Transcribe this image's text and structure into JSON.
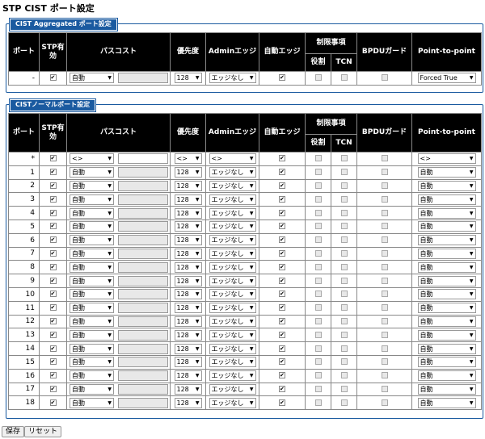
{
  "page_title": "STP CIST ポート設定",
  "agg_legend": "CIST Aggregated ポート設定",
  "normal_legend": "CISTノーマルポート設定",
  "headers": {
    "port": "ポート",
    "stp_enabled": "STP有効",
    "path_cost": "パスコスト",
    "priority": "優先度",
    "admin_edge": "Adminエッジ",
    "auto_edge": "自動エッジ",
    "restricted": "制限事項",
    "role": "役割",
    "tcn": "TCN",
    "bpdu_guard": "BPDUガード",
    "p2p": "Point-to-point"
  },
  "agg_row": {
    "port": "-",
    "stp": true,
    "path_cost": "自動",
    "priority": "128",
    "admin_edge": "エッジなし",
    "auto_edge": true,
    "role": false,
    "tcn": false,
    "bpdu": false,
    "p2p": "Forced True"
  },
  "wildcard_row": {
    "port": "*",
    "stp": true,
    "path_cost": "<>",
    "priority": "<>",
    "admin_edge": "<>",
    "auto_edge": true,
    "role": false,
    "tcn": false,
    "bpdu": false,
    "p2p": "<>"
  },
  "port_rows": [
    {
      "port": "1",
      "path_cost": "自動",
      "priority": "128",
      "admin_edge": "エッジなし",
      "p2p": "自動"
    },
    {
      "port": "2",
      "path_cost": "自動",
      "priority": "128",
      "admin_edge": "エッジなし",
      "p2p": "自動"
    },
    {
      "port": "3",
      "path_cost": "自動",
      "priority": "128",
      "admin_edge": "エッジなし",
      "p2p": "自動"
    },
    {
      "port": "4",
      "path_cost": "自動",
      "priority": "128",
      "admin_edge": "エッジなし",
      "p2p": "自動"
    },
    {
      "port": "5",
      "path_cost": "自動",
      "priority": "128",
      "admin_edge": "エッジなし",
      "p2p": "自動"
    },
    {
      "port": "6",
      "path_cost": "自動",
      "priority": "128",
      "admin_edge": "エッジなし",
      "p2p": "自動"
    },
    {
      "port": "7",
      "path_cost": "自動",
      "priority": "128",
      "admin_edge": "エッジなし",
      "p2p": "自動"
    },
    {
      "port": "8",
      "path_cost": "自動",
      "priority": "128",
      "admin_edge": "エッジなし",
      "p2p": "自動"
    },
    {
      "port": "9",
      "path_cost": "自動",
      "priority": "128",
      "admin_edge": "エッジなし",
      "p2p": "自動"
    },
    {
      "port": "10",
      "path_cost": "自動",
      "priority": "128",
      "admin_edge": "エッジなし",
      "p2p": "自動"
    },
    {
      "port": "11",
      "path_cost": "自動",
      "priority": "128",
      "admin_edge": "エッジなし",
      "p2p": "自動"
    },
    {
      "port": "12",
      "path_cost": "自動",
      "priority": "128",
      "admin_edge": "エッジなし",
      "p2p": "自動"
    },
    {
      "port": "13",
      "path_cost": "自動",
      "priority": "128",
      "admin_edge": "エッジなし",
      "p2p": "自動"
    },
    {
      "port": "14",
      "path_cost": "自動",
      "priority": "128",
      "admin_edge": "エッジなし",
      "p2p": "自動"
    },
    {
      "port": "15",
      "path_cost": "自動",
      "priority": "128",
      "admin_edge": "エッジなし",
      "p2p": "自動"
    },
    {
      "port": "16",
      "path_cost": "自動",
      "priority": "128",
      "admin_edge": "エッジなし",
      "p2p": "自動"
    },
    {
      "port": "17",
      "path_cost": "自動",
      "priority": "128",
      "admin_edge": "エッジなし",
      "p2p": "自動"
    },
    {
      "port": "18",
      "path_cost": "自動",
      "priority": "128",
      "admin_edge": "エッジなし",
      "p2p": "自動"
    }
  ],
  "buttons": {
    "save": "保存",
    "reset": "リセット"
  }
}
